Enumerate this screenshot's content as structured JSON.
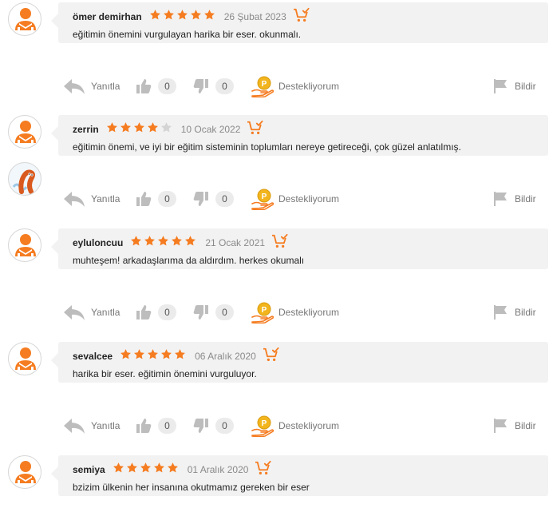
{
  "colors": {
    "accent": "#f57c20",
    "star_empty": "#d4d4d4",
    "bubble": "#f2f2f2",
    "icon_gray": "#bdbdbd"
  },
  "actions": {
    "reply_label": "Yanıtla",
    "support_label": "Destekliyorum",
    "report_label": "Bildir"
  },
  "reviews": [
    {
      "user": "ömer demirhan",
      "rating": 5,
      "date": "26 Şubat 2023",
      "comment": "eğitimin önemini vurgulayan harika bir eser. okunmalı.",
      "likes": "0",
      "dislikes": "0",
      "extra_avatar": false
    },
    {
      "user": "zerrin",
      "rating": 4,
      "date": "10 Ocak 2022",
      "comment": "eğitimin önemi, ve iyi bir eğitim sisteminin toplumları nereye getireceği, çok güzel anlatılmış.",
      "likes": "0",
      "dislikes": "0",
      "extra_avatar": true
    },
    {
      "user": "eyluloncuu",
      "rating": 5,
      "date": "21 Ocak 2021",
      "comment": "muhteşem! arkadaşlarıma da aldırdım. herkes okumalı",
      "likes": "0",
      "dislikes": "0",
      "extra_avatar": false
    },
    {
      "user": "sevalcee",
      "rating": 5,
      "date": "06 Aralık 2020",
      "comment": "harika bir eser. eğitimin önemini vurguluyor.",
      "likes": "0",
      "dislikes": "0",
      "extra_avatar": false
    },
    {
      "user": "semiya",
      "rating": 5,
      "date": "01 Aralık 2020",
      "comment": "bzizim ülkenin her insanına okutmamız gereken bir eser",
      "likes": null,
      "dislikes": null,
      "extra_avatar": false
    }
  ]
}
